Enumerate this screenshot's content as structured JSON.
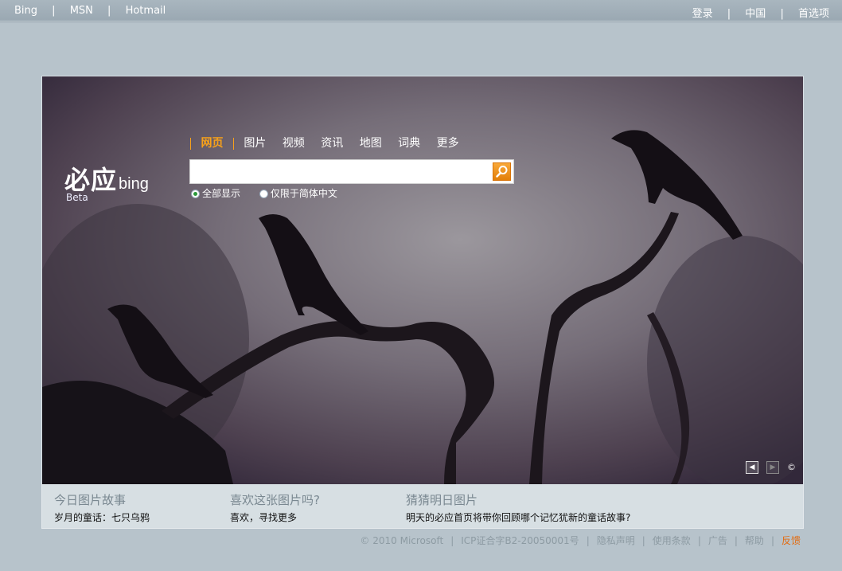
{
  "topnav": {
    "left": [
      "Bing",
      "MSN",
      "Hotmail"
    ],
    "right": [
      "登录",
      "中国",
      "首选项"
    ]
  },
  "brand": {
    "logo_cn": "必应",
    "logo_en": "bing",
    "tag": "Beta"
  },
  "search": {
    "tabs": [
      "网页",
      "图片",
      "视频",
      "资讯",
      "地图",
      "词典",
      "更多"
    ],
    "active_tab": "网页",
    "query": "",
    "radio_all": "全部显示",
    "radio_cn": "仅限于简体中文"
  },
  "info": {
    "story_title": "今日图片故事",
    "story_sub": "岁月的童话：七只乌鸦",
    "like_title": "喜欢这张图片吗?",
    "like_sub": "喜欢，寻找更多",
    "guess_title": "猜猜明日图片",
    "guess_sub": "明天的必应首页将带你回顾哪个记忆犹新的童话故事?"
  },
  "footer": {
    "copyright": "© 2010 Microsoft",
    "icp": "ICP证合字B2-20050001号",
    "privacy": "隐私声明",
    "terms": "使用条款",
    "ads": "广告",
    "help": "帮助",
    "feedback": "反馈"
  },
  "colors": {
    "accent": "#f7a11a",
    "feedback": "#e36b10",
    "page_bg": "#b7c3cb"
  }
}
